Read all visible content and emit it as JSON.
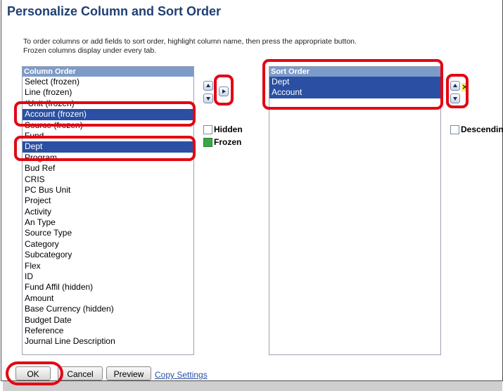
{
  "page": {
    "title": "Personalize Column and Sort Order",
    "instructions_line1": "To order columns or add fields to sort order, highlight column name, then press the appropriate button.",
    "instructions_line2": "Frozen columns display under every tab."
  },
  "column_order": {
    "header": "Column Order",
    "items": [
      {
        "label": "Select (frozen)",
        "selected": false
      },
      {
        "label": "Line (frozen)",
        "selected": false
      },
      {
        "label": "*Unit (frozen)",
        "selected": false
      },
      {
        "label": "Account (frozen)",
        "selected": true
      },
      {
        "label": "Source (frozen)",
        "selected": false
      },
      {
        "label": "Fund",
        "selected": false
      },
      {
        "label": "Dept",
        "selected": true
      },
      {
        "label": "Program",
        "selected": false
      },
      {
        "label": "Bud Ref",
        "selected": false
      },
      {
        "label": "CRIS",
        "selected": false
      },
      {
        "label": "PC Bus Unit",
        "selected": false
      },
      {
        "label": "Project",
        "selected": false
      },
      {
        "label": "Activity",
        "selected": false
      },
      {
        "label": "An Type",
        "selected": false
      },
      {
        "label": "Source Type",
        "selected": false
      },
      {
        "label": "Category",
        "selected": false
      },
      {
        "label": "Subcategory",
        "selected": false
      },
      {
        "label": "Flex",
        "selected": false
      },
      {
        "label": "ID",
        "selected": false
      },
      {
        "label": "Fund Affil (hidden)",
        "selected": false
      },
      {
        "label": "Amount",
        "selected": false
      },
      {
        "label": "Base Currency (hidden)",
        "selected": false
      },
      {
        "label": "Budget Date",
        "selected": false
      },
      {
        "label": "Reference",
        "selected": false
      },
      {
        "label": "Journal Line Description",
        "selected": false
      }
    ]
  },
  "options": {
    "hidden_label": "Hidden",
    "hidden_checked": false,
    "frozen_label": "Frozen",
    "frozen_checked": true,
    "descending_label": "Descending",
    "descending_checked": false
  },
  "sort_order": {
    "header": "Sort Order",
    "items": [
      {
        "label": "Dept",
        "selected": true
      },
      {
        "label": "Account",
        "selected": true
      }
    ]
  },
  "buttons": {
    "ok": "OK",
    "cancel": "Cancel",
    "preview": "Preview",
    "copy_settings": "Copy Settings"
  },
  "icons": {
    "move_up": "arrow-up-icon",
    "move_down": "arrow-down-icon",
    "add_to_sort": "arrow-right-icon",
    "remove_from_sort": "x-remove-icon"
  },
  "colors": {
    "title": "#1f3f73",
    "header_bg": "#7d9bc9",
    "selection": "#2a4fa3",
    "highlight_box": "#e30613",
    "frozen_checkbox": "#39a844"
  }
}
